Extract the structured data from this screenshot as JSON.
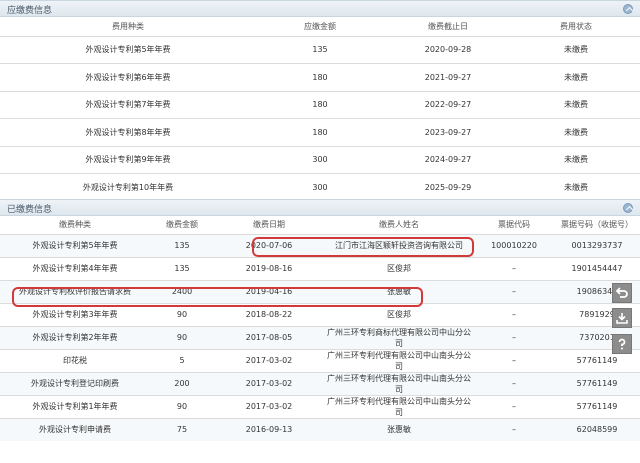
{
  "payable": {
    "title": "应缴费信息",
    "headers": [
      "费用种类",
      "应缴金额",
      "缴费截止日",
      "费用状态"
    ],
    "rows": [
      [
        "外观设计专利第5年年费",
        "135",
        "2020-09-28",
        "未缴费"
      ],
      [
        "外观设计专利第6年年费",
        "180",
        "2021-09-27",
        "未缴费"
      ],
      [
        "外观设计专利第7年年费",
        "180",
        "2022-09-27",
        "未缴费"
      ],
      [
        "外观设计专利第8年年费",
        "180",
        "2023-09-27",
        "未缴费"
      ],
      [
        "外观设计专利第9年年费",
        "300",
        "2024-09-27",
        "未缴费"
      ],
      [
        "外观设计专利第10年年费",
        "300",
        "2025-09-29",
        "未缴费"
      ]
    ]
  },
  "paid": {
    "title": "已缴费信息",
    "headers": [
      "缴费种类",
      "缴费金额",
      "缴费日期",
      "缴费人姓名",
      "票据代码",
      "票据号码（收据号）"
    ],
    "rows": [
      [
        "外观设计专利第5年年费",
        "135",
        "2020-07-06",
        "江门市江海区颖轩投资咨询有限公司",
        "100010220",
        "0013293737"
      ],
      [
        "外观设计专利第4年年费",
        "135",
        "2019-08-16",
        "区俊邦",
        "–",
        "1901454447"
      ],
      [
        "外观设计专利权评价报告请求费",
        "2400",
        "2019-04-16",
        "张惠敏",
        "–",
        "19086348"
      ],
      [
        "外观设计专利第3年年费",
        "90",
        "2018-08-22",
        "区俊邦",
        "–",
        "7891929"
      ],
      [
        "外观设计专利第2年年费",
        "90",
        "2017-08-05",
        "广州三环专利商标代理有限公司中山分公司",
        "–",
        "7370201"
      ],
      [
        "印花税",
        "5",
        "2017-03-02",
        "广州三环专利代理有限公司中山南头分公司",
        "–",
        "57761149"
      ],
      [
        "外观设计专利登记印刷费",
        "200",
        "2017-03-02",
        "广州三环专利代理有限公司中山南头分公司",
        "–",
        "57761149"
      ],
      [
        "外观设计专利第1年年费",
        "90",
        "2017-03-02",
        "广州三环专利代理有限公司中山南头分公司",
        "–",
        "57761149"
      ],
      [
        "外观设计专利申请费",
        "75",
        "2016-09-13",
        "张惠敏",
        "–",
        "62048599"
      ]
    ]
  },
  "side_tools": [
    "back-icon",
    "download-icon",
    "help-icon"
  ],
  "colors": {
    "highlight": "#d23a3a",
    "header_bg": "#e6edf3"
  }
}
